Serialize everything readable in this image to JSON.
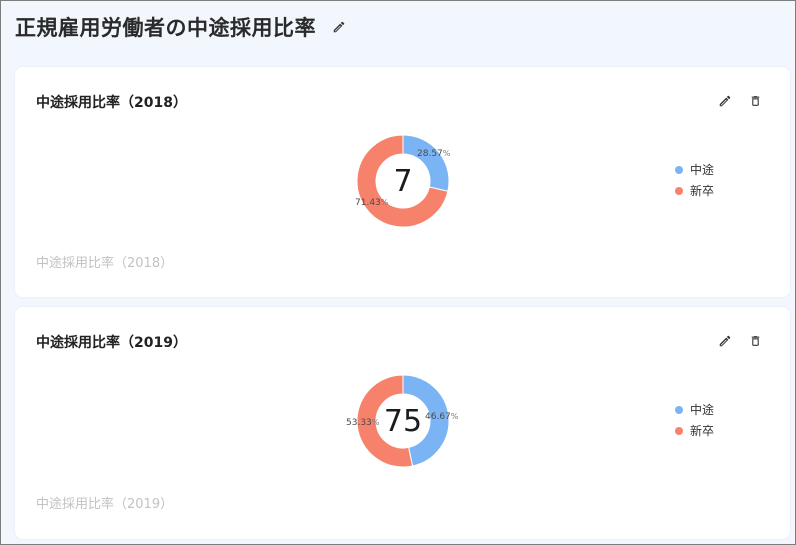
{
  "page": {
    "title": "正規雇用労働者の中途採用比率"
  },
  "colors": {
    "mid_career": "#7ab4f5",
    "new_grad": "#f7826b"
  },
  "icons": {
    "edit": "pencil-icon",
    "delete": "trash-icon"
  },
  "cards": [
    {
      "title": "中途採用比率（2018）",
      "footer": "中途採用比率（2018）",
      "center_value": "7",
      "slices": [
        {
          "label": "中途",
          "pct_text": "28.57",
          "unit": "%"
        },
        {
          "label": "新卒",
          "pct_text": "71.43",
          "unit": "%"
        }
      ]
    },
    {
      "title": "中途採用比率（2019）",
      "footer": "中途採用比率（2019）",
      "center_value": "75",
      "slices": [
        {
          "label": "中途",
          "pct_text": "46.67",
          "unit": "%"
        },
        {
          "label": "新卒",
          "pct_text": "53.33",
          "unit": "%"
        }
      ]
    }
  ],
  "chart_data": [
    {
      "type": "pie",
      "title": "中途採用比率（2018）",
      "categories": [
        "中途",
        "新卒"
      ],
      "values": [
        28.57,
        71.43
      ],
      "center_label": "7",
      "legend": "right"
    },
    {
      "type": "pie",
      "title": "中途採用比率（2019）",
      "categories": [
        "中途",
        "新卒"
      ],
      "values": [
        46.67,
        53.33
      ],
      "center_label": "75",
      "legend": "right"
    }
  ]
}
